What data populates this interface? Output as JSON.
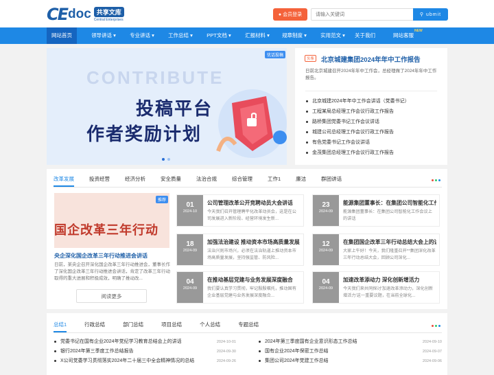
{
  "header": {
    "logo_main": "CE",
    "logo_doc": "doc",
    "logo_cn": "共享文库",
    "logo_en": "Central Enterprises",
    "vip_label": "会员登录",
    "search_placeholder": "请输入关键词",
    "submit_label": "ubmit"
  },
  "nav": {
    "items": [
      {
        "label": "网站首页",
        "active": true
      },
      {
        "label": "领导讲话 ▾"
      },
      {
        "label": "专业讲话 ▾"
      },
      {
        "label": "工作总结 ▾"
      },
      {
        "label": "PPT文档 ▾"
      },
      {
        "label": "汇报材料 ▾"
      },
      {
        "label": "规章制度 ▾"
      },
      {
        "label": "实用范文 ▾"
      },
      {
        "label": "关于我们"
      },
      {
        "label": "网站客服"
      }
    ],
    "new_badge": "NEW"
  },
  "banner": {
    "tag": "优话投稿",
    "big_text": "CONTRIBUTE",
    "line1": "投稿平台",
    "line2": "作者奖励计划"
  },
  "headline": {
    "tag": "头条",
    "title": "北京城建集团2024年年中工作报告",
    "desc": "日前北京城建召开2024年年中工作会，总经理做了2024年年中工作报告。",
    "list": [
      "北京城建2024年年中工作会讲话（党委书记）",
      "工程某局总经理工作会议行政工作报告",
      "路桥集团党委书记工作会议讲话",
      "城建公司总经理工作会议行政工作报告",
      "有色党委书记工作会议讲话",
      "金茂集团总经理工作会议行政工作报告"
    ]
  },
  "reform": {
    "tabs": [
      "改革发展",
      "投资经营",
      "经济分析",
      "安全质量",
      "法治合规",
      "综合管理",
      "工作1",
      "廉洁",
      "群团讲话"
    ],
    "tri_colors": [
      "#e74c3c",
      "#2ecc71",
      "#1e88e5"
    ],
    "feature": {
      "tag": "推荐",
      "pic_text": "国企改革三年行动",
      "title": "央企深化国企改革三年行动推进会讲话",
      "desc": "日前，某央企召开深化国企改革三年行动推进会，董事长作了深化国企改革三年行动推进会讲话，肯定了改革三年行动取得的重大进展和积极成效，明确了推动改...",
      "readmore": "阅读更多"
    },
    "cards": [
      {
        "day": "01",
        "ym": "2024-10",
        "title": "公司管理改革公开竞聘动员大会讲话",
        "desc": "今天我们召开管理聘平化改革动员会，这是在公司发展进入新阶段、经营环境发生新..."
      },
      {
        "day": "23",
        "ym": "2024-09",
        "title": "能源集团董事长：在集团公司智能化工作会",
        "desc": "能源集团董事长：在集团公司智能化工作会议上的讲话"
      },
      {
        "day": "18",
        "ym": "2024-09",
        "title": "加强法治建设 推动资本市场高质量发展",
        "desc": "法治兴则市场兴，必须在法治轨道上推动资本市场高质量发展，坚持强监管、防风险..."
      },
      {
        "day": "12",
        "ym": "2024-09",
        "title": "在集团国企改革三年行动总结大会上的讲话",
        "desc": "大家上午好！今天，我们隆重召开**集团深化改革三年行动总结大会，回顾公司深化..."
      },
      {
        "day": "04",
        "ym": "2024-09",
        "title": "在推动基层党建与业务发展深度融合",
        "desc": "我们要认真学习贯彻，牢记殷殷嘱托，推动国有企业基层党建与业务发展深度融合..."
      },
      {
        "day": "04",
        "ym": "2024-09",
        "title": "加速改革添动力 深化创新增活力",
        "desc": "今天我们来共同探讨'加速改革添动力，深化创新增活力'这一重要议题，在当前全球化..."
      }
    ]
  },
  "summary": {
    "tabs": [
      "总结1",
      "行政总结",
      "部门总结",
      "项目总结",
      "个人总结",
      "专题总结"
    ],
    "left": [
      {
        "title": "党委书记在国有企业2024年党纪学习教育总结会上的讲话",
        "date": "2024-10-01"
      },
      {
        "title": "银行2024年第三季度工作总结报告",
        "date": "2024-09-30"
      },
      {
        "title": "X公司党委学习贯彻落实2024年二十届三中全会精神情况的总结",
        "date": "2024-09-26"
      }
    ],
    "right": [
      {
        "title": "2024年第三季度国有企业意识形态工作总结",
        "date": "2024-09-10"
      },
      {
        "title": "国有企业2024年保密工作总结",
        "date": "2024-09-07"
      },
      {
        "title": "集团公司2024年党建工作总结",
        "date": "2024-09-06"
      }
    ]
  }
}
